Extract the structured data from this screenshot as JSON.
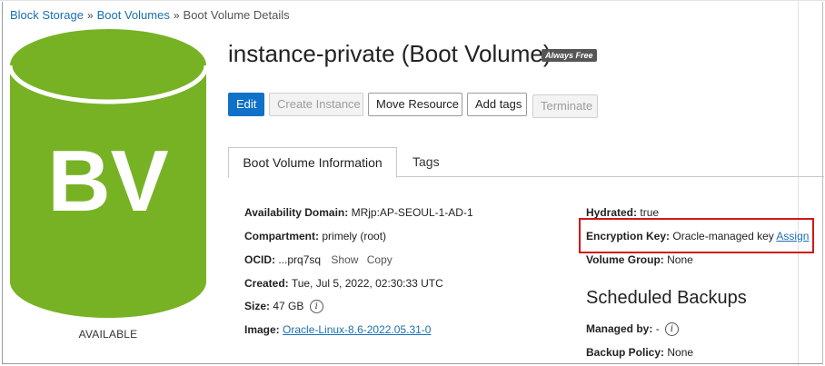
{
  "breadcrumb": {
    "items": [
      "Block Storage",
      "Boot Volumes"
    ],
    "separator": "»",
    "current": "Boot Volume Details"
  },
  "logo": {
    "text": "BV",
    "color": "#77b224",
    "status": "AVAILABLE"
  },
  "header": {
    "title": "instance-private (Boot Volume)",
    "badge": "Always Free"
  },
  "actions": {
    "edit": "Edit",
    "create_instance": "Create Instance",
    "move_resource": "Move Resource",
    "add_tags": "Add tags",
    "terminate": "Terminate"
  },
  "tabs": [
    {
      "label": "Boot Volume Information",
      "active": true
    },
    {
      "label": "Tags",
      "active": false
    }
  ],
  "info_left": {
    "availability_domain": {
      "label": "Availability Domain:",
      "value": "MRjp:AP-SEOUL-1-AD-1"
    },
    "compartment": {
      "label": "Compartment:",
      "value": "primely (root)"
    },
    "ocid": {
      "label": "OCID:",
      "value": "...prq7sq",
      "show": "Show",
      "copy": "Copy"
    },
    "created": {
      "label": "Created:",
      "value": "Tue, Jul 5, 2022, 02:30:33 UTC"
    },
    "size": {
      "label": "Size:",
      "value": "47 GB"
    },
    "image": {
      "label": "Image:",
      "value": "Oracle-Linux-8.6-2022.05.31-0"
    }
  },
  "info_right": {
    "hydrated": {
      "label": "Hydrated:",
      "value": "true"
    },
    "encryption_key": {
      "label": "Encryption Key:",
      "value": "Oracle-managed key",
      "action": "Assign"
    },
    "volume_group": {
      "label": "Volume Group:",
      "value": "None"
    }
  },
  "scheduled_backups": {
    "title": "Scheduled Backups",
    "managed_by": {
      "label": "Managed by:",
      "value": "-"
    },
    "backup_policy": {
      "label": "Backup Policy:",
      "value": "None"
    }
  },
  "colors": {
    "primary_button": "#0f72c8",
    "link": "#1a6fb3",
    "highlight": "#d01818",
    "badge_bg": "#555555"
  }
}
